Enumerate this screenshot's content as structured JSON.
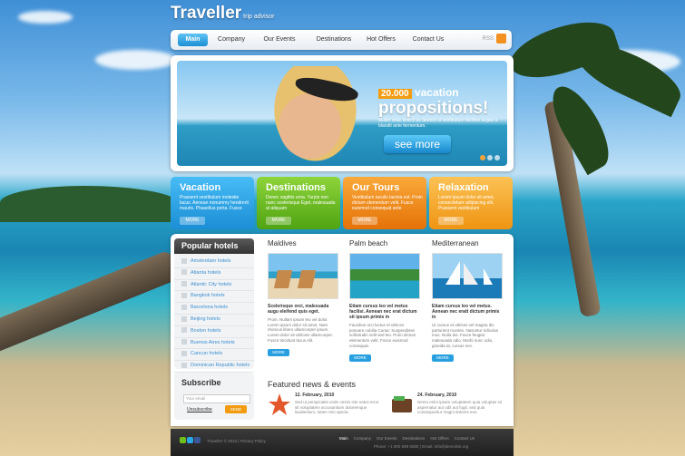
{
  "site": {
    "name": "Traveller",
    "tagline": "trip advisor"
  },
  "nav": {
    "items": [
      {
        "label": "Main"
      },
      {
        "label": "Company"
      },
      {
        "label": "Our Events"
      },
      {
        "label": "Destinations"
      },
      {
        "label": "Hot Offers"
      },
      {
        "label": "Contact Us"
      }
    ],
    "rss": "RSS"
  },
  "slider": {
    "badge": "20.000",
    "headline_small": "vacation",
    "headline_big": "propositions!",
    "subtext": "Mullet vitae sollicit ac laoreet ut vestibulum facilisis augue a blandit ante fermentum.",
    "cta": "see more"
  },
  "features": [
    {
      "title": "Vacation",
      "text": "Praesent vestibulum molestie lacus. Aenean nonummy hendrerit mauris. Phasellus porta. Fusce",
      "more": "MORE",
      "color": "#2aa7e8"
    },
    {
      "title": "Destinations",
      "text": "Donec sagittis urna. Turpis non nunc scelerisque Eget, malesuada at aliquam",
      "more": "MORE",
      "color": "#6fbe1e"
    },
    {
      "title": "Our Tours",
      "text": "Vestibulum iaculis lacinia est. Proin dictum elementum velit. Fusce euismod consequat ante",
      "more": "MORE",
      "color": "#f08a12"
    },
    {
      "title": "Relaxation",
      "text": "Lorem ipsum dolor sit amet, consectetuer adipiscing elit. Praesent vestibulum",
      "more": "MORE",
      "color": "#f5a623"
    }
  ],
  "popular": {
    "title": "Popular hotels",
    "items": [
      "Amsterdam hotels",
      "Atlanta hotels",
      "Atlantic City hotels",
      "Bangkok hotels",
      "Barcelona hotels",
      "Beijing hotels",
      "Boston hotels",
      "Buenos Aires hotels",
      "Cancun hotels",
      "Dominican Republic hotels"
    ]
  },
  "subscribe": {
    "title": "Subscribe",
    "placeholder": "Your email",
    "unsubscribe": "Unsubscribe",
    "submit": "SEND"
  },
  "destinations": [
    {
      "title": "Maldives",
      "lead": "Scelerisque orci, malesuada augu eleifend quis eget.",
      "text": "Proin. Nullam ipsum leo vel dolor. Lorem ipsum dolor sit amet. Nam rhoncus libero ullamcorper ipsum. Lorem dolor sit ultricies ullamcorper. Fusce tincidunt lacus elit.",
      "more": "MORE"
    },
    {
      "title": "Palm beach",
      "lead": "Etiam cursus leo vel metus facilisi. Aenean nec erat dictum sit ipsum primis in",
      "text": "Faucibus orci luctus et ultrices posuere cubilia Curae; Suspendisse sollicitudin velit sed leo. Proin dictum elementum velit. Fusce euismod consequat.",
      "more": "MORE"
    },
    {
      "title": "Mediterranean",
      "lead": "Etiam cursus leo vel metus. Aenean nec eratt dictum primis in",
      "text": "Ut cursus et ultrices vel magna dis parturient montes. Nascetur ridiculus mus. Nulla dui. Fusce feugiat malesuada odio. Morbi nunc odio, gravida at, cursus nec.",
      "more": "MORE"
    }
  ],
  "news": {
    "title": "Featured news & events",
    "items": [
      {
        "date": "12. February, 2010",
        "text": "Sed ut perspiciatis unde omnis iste natus error sit voluptatem accusantium doloremque laudantium, totam rem aperia."
      },
      {
        "date": "24. February, 2010",
        "text": "Nemo enim ipsam voluptatem quia voluptas sit aspernatur aut odit aut fugit, sed quia consequuntur magni dolores eos."
      }
    ]
  },
  "footer": {
    "copyright": "Traveller © 2010 | Privacy Policy",
    "links": [
      "Main",
      "Company",
      "Our Events",
      "Destinations",
      "Hot Offers",
      "Contact Us"
    ],
    "contact": "Phone: +1 800 559 6580 | Email: info@demolink.org"
  }
}
